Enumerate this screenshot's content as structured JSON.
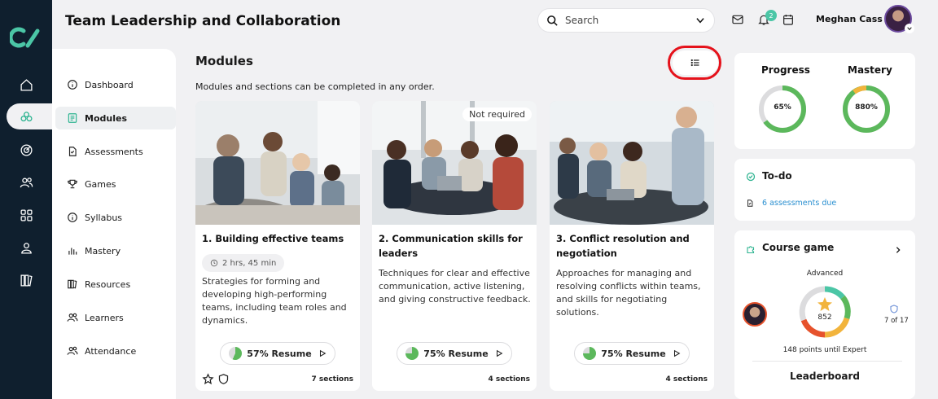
{
  "header": {
    "title": "Team Leadership and Collaboration",
    "search_placeholder": "Search",
    "notifications_count": "2",
    "user_name": "Meghan Cass"
  },
  "rail": {
    "icons": [
      "logo",
      "home-icon",
      "modules-icon",
      "target-icon",
      "people-icon",
      "grid-icon",
      "person-icon",
      "library-icon"
    ]
  },
  "nav": {
    "items": [
      {
        "label": "Dashboard",
        "icon": "info-icon"
      },
      {
        "label": "Modules",
        "icon": "book-icon",
        "active": true
      },
      {
        "label": "Assessments",
        "icon": "file-icon"
      },
      {
        "label": "Games",
        "icon": "trophy-icon"
      },
      {
        "label": "Syllabus",
        "icon": "info-icon"
      },
      {
        "label": "Mastery",
        "icon": "bar-chart-icon"
      },
      {
        "label": "Resources",
        "icon": "books-icon"
      },
      {
        "label": "Learners",
        "icon": "users-icon"
      },
      {
        "label": "Attendance",
        "icon": "users-icon"
      }
    ]
  },
  "main": {
    "title": "Modules",
    "subtitle": "Modules and sections can be completed in any order.",
    "cards": [
      {
        "title": "1. Building effective teams",
        "duration": "2 hrs, 45 min",
        "description": "Strategies for forming and developing high-performing teams, including team roles and dynamics.",
        "progress_pct": 57,
        "resume_label": "57% Resume",
        "sections": "7 sections"
      },
      {
        "title": "2. Communication skills for leaders",
        "tag": "Not required",
        "description": "Techniques for clear and effective communication, active listening, and giving constructive feedback.",
        "progress_pct": 75,
        "resume_label": "75% Resume",
        "sections": "4 sections"
      },
      {
        "title": "3. Conflict resolution and negotiation",
        "description": "Approaches for managing and resolving conflicts within teams, and skills for negotiating solutions.",
        "progress_pct": 75,
        "resume_label": "75% Resume",
        "sections": "4 sections"
      }
    ]
  },
  "stats": {
    "progress_label": "Progress",
    "progress_value": "65%",
    "progress_pct": 65,
    "mastery_label": "Mastery",
    "mastery_value": "880%",
    "mastery_pct": 100
  },
  "todo": {
    "title": "To-do",
    "link": "6 assessments due"
  },
  "course_game": {
    "title": "Course game",
    "level": "Advanced",
    "score": "852",
    "rank": "7 of 17",
    "points_until": "148 points until Expert",
    "leaderboard": "Leaderboard"
  },
  "colors": {
    "green": "#5cb85c",
    "accent_teal": "#4bc6a6",
    "link_blue": "#2a8fd0",
    "highlight_red": "#e5121b"
  }
}
